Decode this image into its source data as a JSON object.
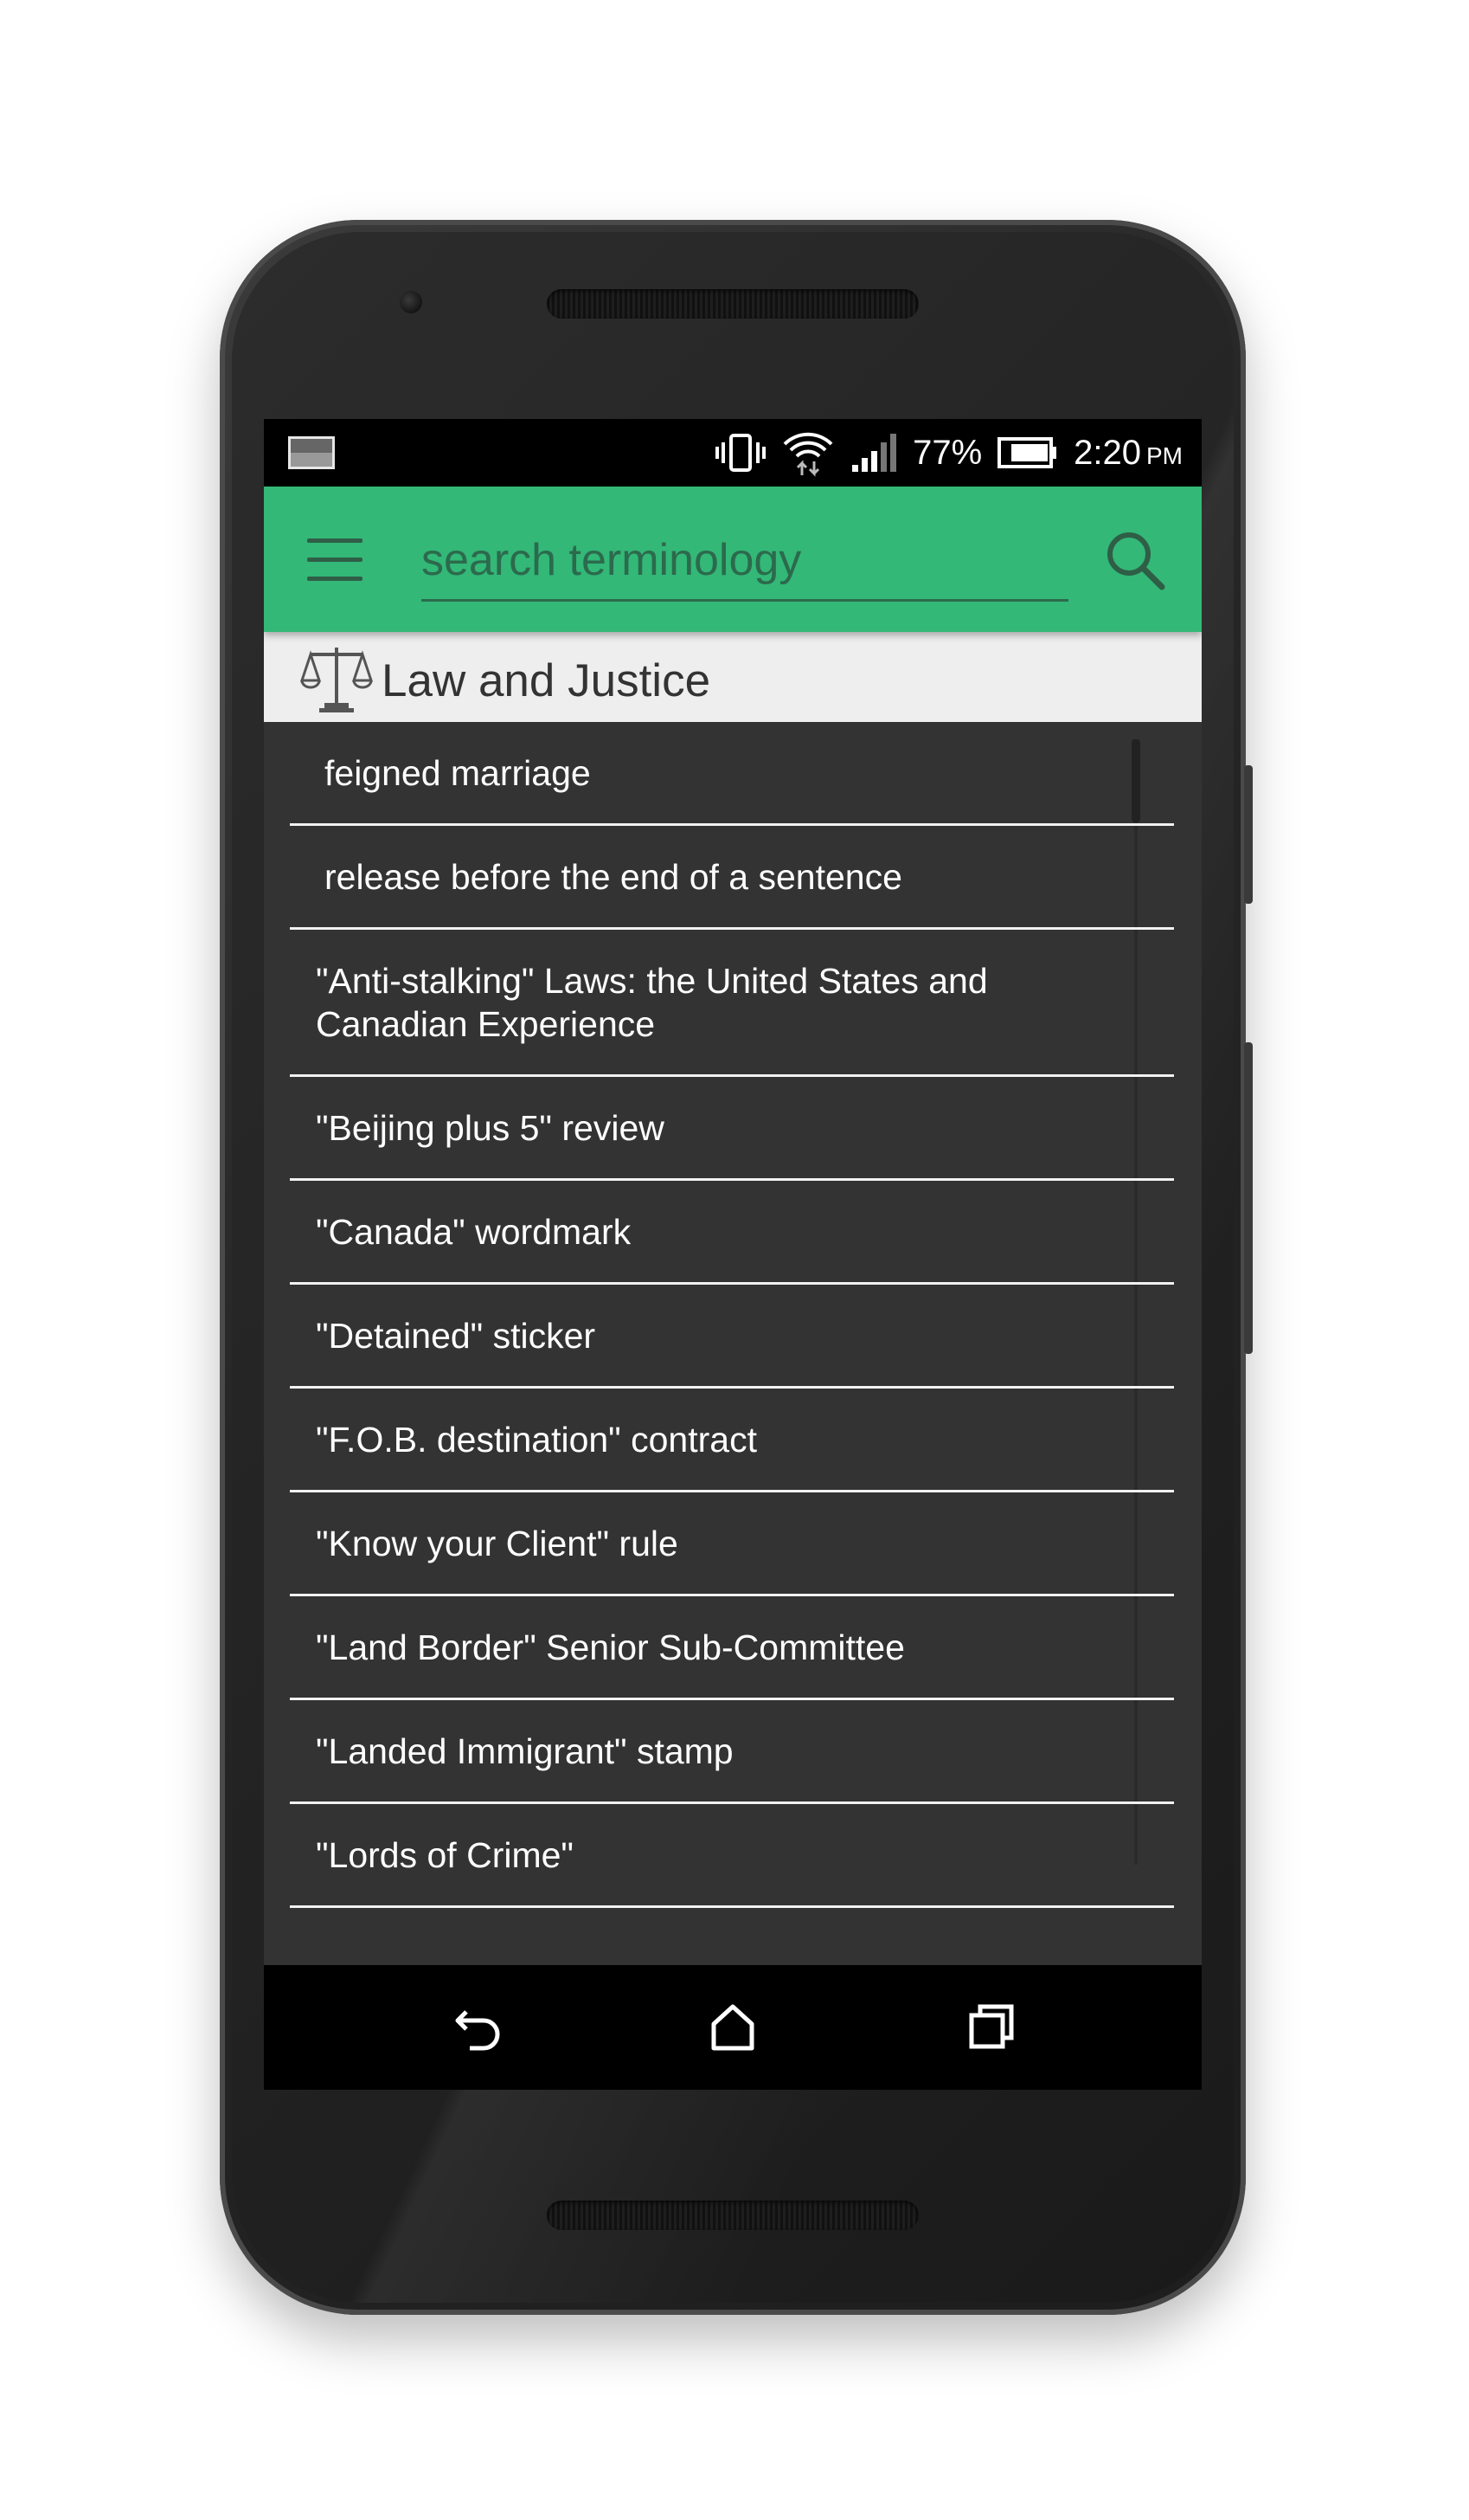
{
  "status_bar": {
    "battery_percent": "77%",
    "time": "2:20",
    "time_suffix": "PM",
    "icons": [
      "gallery-icon",
      "vibrate-icon",
      "wifi-icon",
      "signal-icon",
      "battery-icon"
    ]
  },
  "toolbar": {
    "search_placeholder": "search terminology",
    "search_value": "",
    "menu_icon": "hamburger-menu-icon",
    "search_icon": "search-icon",
    "color": "#33b877"
  },
  "category": {
    "title": "Law and Justice",
    "icon": "scales-of-justice-icon"
  },
  "terms": [
    "feigned marriage",
    "release before the end of a sentence",
    "\"Anti-stalking\" Laws: the United States and Canadian Experience",
    "\"Beijing plus 5\" review",
    "\"Canada\" wordmark",
    "\"Detained\" sticker",
    "\"F.O.B. destination\" contract",
    "\"Know your Client\" rule",
    "\"Land Border\" Senior Sub-Committee",
    "\"Landed Immigrant\" stamp",
    "\"Lords of Crime\""
  ],
  "nav_bar": {
    "buttons": [
      "back-icon",
      "home-icon",
      "recents-icon"
    ]
  }
}
